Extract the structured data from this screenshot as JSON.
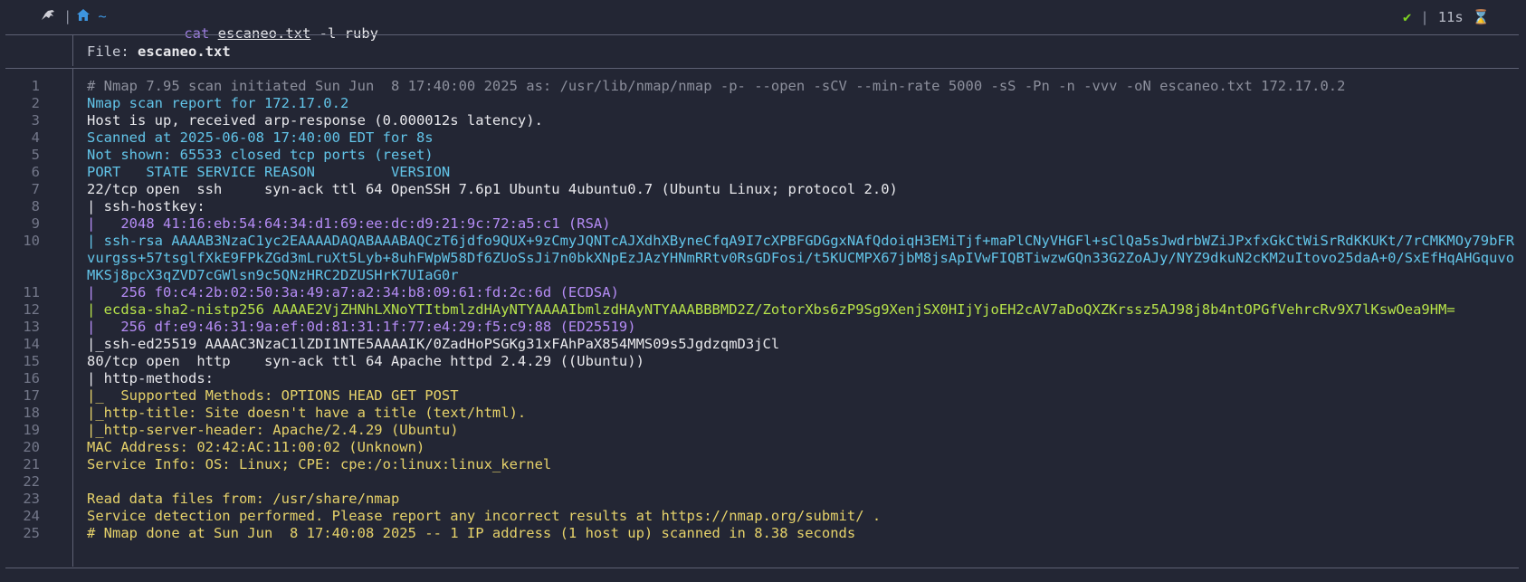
{
  "titlebar": {
    "os_icon": "tux-icon",
    "dir_icon": "home-icon",
    "dir_label": "~",
    "command": "cat",
    "file": "escaneo.txt",
    "args": "-l ruby",
    "status_ok": "✔",
    "duration": "11s",
    "hourglass": "⌛"
  },
  "viewer": {
    "file_label": "File: ",
    "file_name": "escaneo.txt"
  },
  "lines": [
    {
      "n": "1",
      "t": "# Nmap 7.95 scan initiated Sun Jun  8 17:40:00 2025 as: /usr/lib/nmap/nmap -p- --open -sCV --min-rate 5000 -sS -Pn -n -vvv -oN escaneo.txt 172.17.0.2"
    },
    {
      "n": "2",
      "t": "Nmap scan report for 172.17.0.2"
    },
    {
      "n": "3",
      "t": "Host is up, received arp-response (0.000012s latency)."
    },
    {
      "n": "4",
      "t": "Scanned at 2025-06-08 17:40:00 EDT for 8s"
    },
    {
      "n": "5",
      "t": "Not shown: 65533 closed tcp ports (reset)"
    },
    {
      "n": "6",
      "t": "PORT   STATE SERVICE REASON         VERSION"
    },
    {
      "n": "7",
      "t": "22/tcp open  ssh     syn-ack ttl 64 OpenSSH 7.6p1 Ubuntu 4ubuntu0.7 (Ubuntu Linux; protocol 2.0)"
    },
    {
      "n": "8",
      "t": "| ssh-hostkey:"
    },
    {
      "n": "9",
      "t": "|   2048 41:16:eb:54:64:34:d1:69:ee:dc:d9:21:9c:72:a5:c1 (RSA)"
    },
    {
      "n": "10",
      "t": "| ssh-rsa AAAAB3NzaC1yc2EAAAADAQABAAABAQCzT6jdfo9QUX+9zCmyJQNTcAJXdhXByneCfqA9I7cXPBFGDGgxNAfQdoiqH3EMiTjf+maPlCNyVHGFl+sClQa5sJwdrbWZiJPxfxGkCtWiSrRdKKUKt/7rCMKMOy79bFRvurgss+57tsglfXkE9FPkZGd3mLruXt5Lyb+8uhFWpW58Df6ZUoSsJi7n0bkXNpEzJAzYHNmRRtv0RsGDFosi/t5KUCMPX67jbM8jsApIVwFIQBTiwzwGQn33G2ZoAJy/NYZ9dkuN2cKM2uItovo25daA+0/SxEfHqAHGquvoMKSj8pcX3qZVD7cGWlsn9c5QNzHRC2DZUSHrK7UIaG0r"
    },
    {
      "n": "11",
      "t": "|   256 f0:c4:2b:02:50:3a:49:a7:a2:34:b8:09:61:fd:2c:6d (ECDSA)"
    },
    {
      "n": "12",
      "t": "| ecdsa-sha2-nistp256 AAAAE2VjZHNhLXNoYTItbmlzdHAyNTYAAAAIbmlzdHAyNTYAAABBBMD2Z/ZotorXbs6zP9Sg9XenjSX0HIjYjoEH2cAV7aDoQXZKrssz5AJ98j8b4ntOPGfVehrcRv9X7lKswOea9HM="
    },
    {
      "n": "13",
      "t": "|   256 df:e9:46:31:9a:ef:0d:81:31:1f:77:e4:29:f5:c9:88 (ED25519)"
    },
    {
      "n": "14",
      "t": "|_ssh-ed25519 AAAAC3NzaC1lZDI1NTE5AAAAIK/0ZadHoPSGKg31xFAhPaX854MMS09s5JgdzqmD3jCl"
    },
    {
      "n": "15",
      "t": "80/tcp open  http    syn-ack ttl 64 Apache httpd 2.4.29 ((Ubuntu))"
    },
    {
      "n": "16",
      "t": "| http-methods:"
    },
    {
      "n": "17",
      "t": "|_  Supported Methods: OPTIONS HEAD GET POST"
    },
    {
      "n": "18",
      "t": "|_http-title: Site doesn't have a title (text/html)."
    },
    {
      "n": "19",
      "t": "|_http-server-header: Apache/2.4.29 (Ubuntu)"
    },
    {
      "n": "20",
      "t": "MAC Address: 02:42:AC:11:00:02 (Unknown)"
    },
    {
      "n": "21",
      "t": "Service Info: OS: Linux; CPE: cpe:/o:linux:linux_kernel"
    },
    {
      "n": "22",
      "t": ""
    },
    {
      "n": "23",
      "t": "Read data files from: /usr/share/nmap"
    },
    {
      "n": "24",
      "t": "Service detection performed. Please report any incorrect results at https://nmap.org/submit/ ."
    },
    {
      "n": "25",
      "t": "# Nmap done at Sun Jun  8 17:40:08 2025 -- 1 IP address (1 host up) scanned in 8.38 seconds"
    }
  ]
}
